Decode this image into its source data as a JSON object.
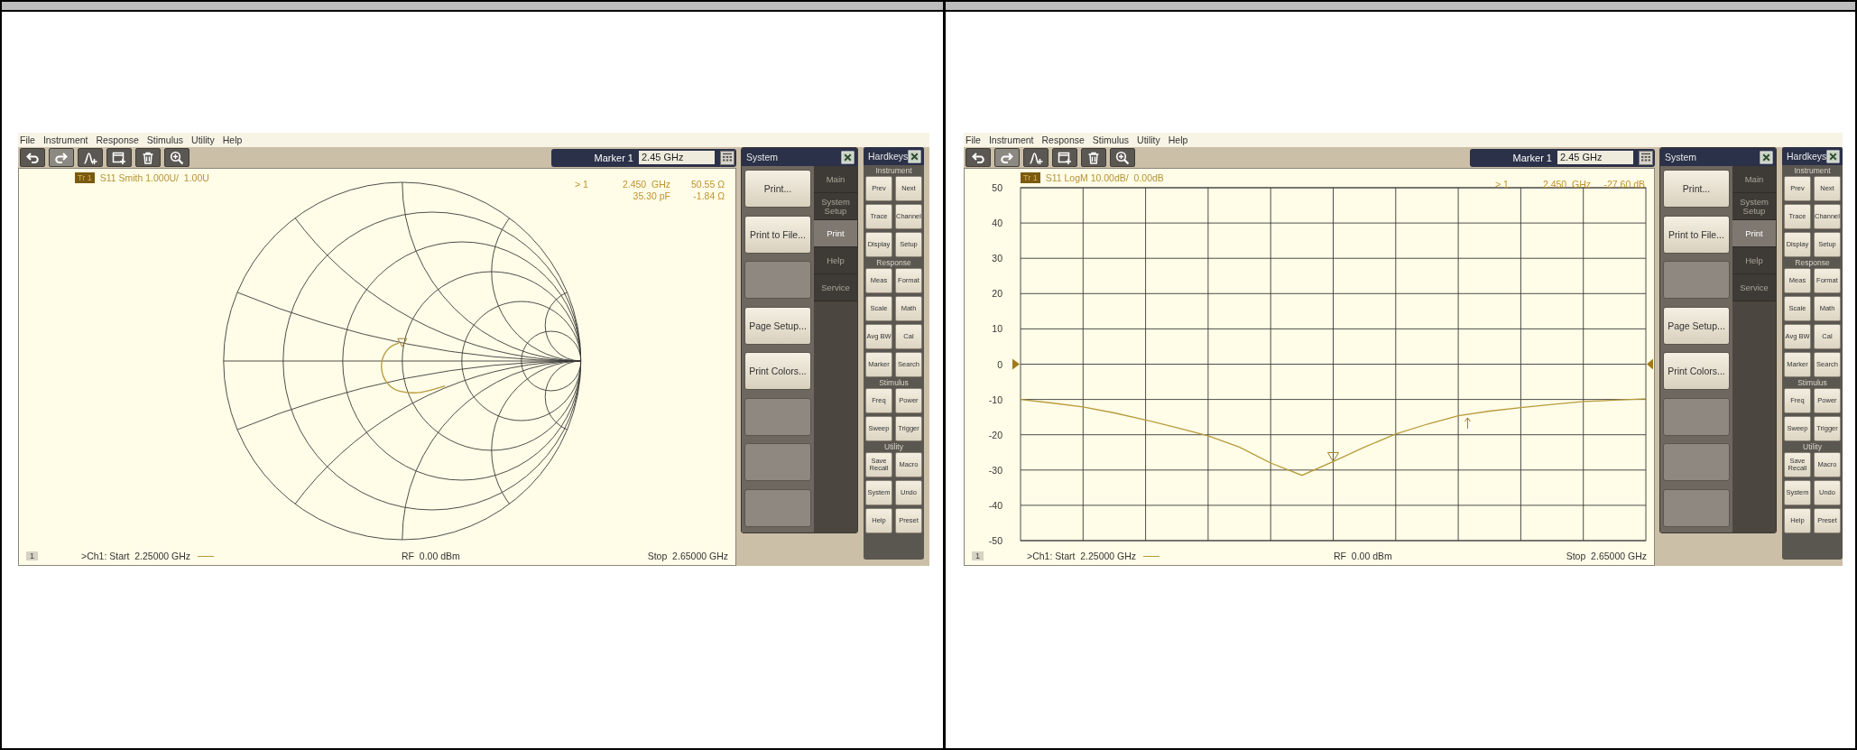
{
  "panes": [
    {
      "menu": [
        "File",
        "Instrument",
        "Response",
        "Stimulus",
        "Utility",
        "Help"
      ],
      "toolbar": [
        {
          "kind": "undo",
          "disabled": false
        },
        {
          "kind": "redo",
          "disabled": true
        },
        {
          "kind": "marker",
          "disabled": false
        },
        {
          "kind": "window",
          "disabled": false
        },
        {
          "kind": "trash",
          "disabled": false
        },
        {
          "kind": "zoom",
          "disabled": false
        }
      ],
      "marker": {
        "label": "Marker 1",
        "value": "2.45 GHz"
      },
      "chart": {
        "kind": "smith",
        "trace_badge": "Tr 1",
        "trace_label": "S11 Smith 1.000U/  1.00U",
        "readout": [
          {
            "marker": "> 1",
            "col_2": "2.450  GHz",
            "col_3": "50.55 Ω"
          },
          {
            "col_2": "35.30 pF",
            "col_3": "-1.84 Ω"
          }
        ]
      },
      "status": {
        "channel_number": "1",
        "start": ">Ch1: Start  2.25000 GHz",
        "rf": "RF  0.00 dBm",
        "stop": "Stop  2.65000 GHz"
      },
      "system": {
        "title": "System",
        "buttons": [
          {
            "kind": "action",
            "label": "Print..."
          },
          {
            "kind": "action",
            "label": "Print to File..."
          },
          {
            "kind": "blank"
          },
          {
            "kind": "action",
            "label": "Page Setup..."
          },
          {
            "kind": "action",
            "label": "Print Colors..."
          },
          {
            "kind": "blank"
          },
          {
            "kind": "blank"
          },
          {
            "kind": "blank"
          }
        ],
        "tabs": [
          {
            "label": "Main",
            "selected": false
          },
          {
            "label": "System Setup",
            "selected": false
          },
          {
            "label": "Print",
            "selected": true
          },
          {
            "label": "Help",
            "selected": false
          },
          {
            "label": "Service",
            "selected": false
          }
        ]
      },
      "hardkeys": {
        "title": "Hardkeys",
        "groups": [
          {
            "label": "Instrument",
            "keys": [
              "Prev",
              "Next",
              "Trace",
              "Channel",
              "Display",
              "Setup"
            ]
          },
          {
            "label": "Response",
            "keys": [
              "Meas",
              "Format",
              "Scale",
              "Math",
              "Avg BW",
              "Cal",
              "Marker",
              "Search"
            ]
          },
          {
            "label": "Stimulus",
            "keys": [
              "Freq",
              "Power",
              "Sweep",
              "Trigger"
            ]
          },
          {
            "label": "Utility",
            "keys": [
              "Save Recall",
              "Macro",
              "System",
              "Undo",
              "Help",
              "Preset"
            ]
          }
        ]
      }
    },
    {
      "menu": [
        "File",
        "Instrument",
        "Response",
        "Stimulus",
        "Utility",
        "Help"
      ],
      "toolbar": [
        {
          "kind": "undo",
          "disabled": false
        },
        {
          "kind": "redo",
          "disabled": true
        },
        {
          "kind": "marker",
          "disabled": false
        },
        {
          "kind": "window",
          "disabled": false
        },
        {
          "kind": "trash",
          "disabled": false
        },
        {
          "kind": "zoom",
          "disabled": false
        }
      ],
      "marker": {
        "label": "Marker 1",
        "value": "2.45 GHz"
      },
      "chart": {
        "kind": "logm",
        "trace_badge": "Tr 1",
        "trace_label": "S11 LogM 10.00dB/  0.00dB",
        "readout": [
          {
            "marker": "> 1",
            "col_2": "2.450  GHz",
            "col_3": "-27.60 dB"
          }
        ],
        "chart_data": {
          "type": "line",
          "grid": true,
          "ylim": [
            -50,
            50
          ],
          "yticks": [
            50,
            40,
            30,
            20,
            10,
            0,
            -10,
            -20,
            -30,
            -40,
            -50
          ],
          "categories": [
            null,
            null,
            null,
            null,
            null,
            null,
            null,
            null,
            null,
            null,
            null,
            null,
            null,
            null,
            null,
            null,
            null,
            null,
            null,
            null,
            null
          ],
          "series": [
            {
              "color": "#b89a3c",
              "values": [
                -10,
                -11,
                -12.1,
                -13.8,
                -15.8,
                -18,
                -20.3,
                -23.5,
                -28,
                -31.5,
                -27.6,
                -23.5,
                -19.8,
                -17,
                -14.6,
                -13.3,
                -12.3,
                -11.4,
                -10.6,
                -10.2,
                -9.8
              ]
            }
          ]
        }
      },
      "status": {
        "channel_number": "1",
        "start": ">Ch1: Start  2.25000 GHz",
        "rf": "RF  0.00 dBm",
        "stop": "Stop  2.65000 GHz"
      },
      "system": {
        "title": "System",
        "buttons": [
          {
            "kind": "action",
            "label": "Print..."
          },
          {
            "kind": "action",
            "label": "Print to File..."
          },
          {
            "kind": "blank"
          },
          {
            "kind": "action",
            "label": "Page Setup..."
          },
          {
            "kind": "action",
            "label": "Print Colors..."
          },
          {
            "kind": "blank"
          },
          {
            "kind": "blank"
          },
          {
            "kind": "blank"
          }
        ],
        "tabs": [
          {
            "label": "Main",
            "selected": false
          },
          {
            "label": "System Setup",
            "selected": false
          },
          {
            "label": "Print",
            "selected": true
          },
          {
            "label": "Help",
            "selected": false
          },
          {
            "label": "Service",
            "selected": false
          }
        ]
      },
      "hardkeys": {
        "title": "Hardkeys",
        "groups": [
          {
            "label": "Instrument",
            "keys": [
              "Prev",
              "Next",
              "Trace",
              "Channel",
              "Display",
              "Setup"
            ]
          },
          {
            "label": "Response",
            "keys": [
              "Meas",
              "Format",
              "Scale",
              "Math",
              "Avg BW",
              "Cal",
              "Marker",
              "Search"
            ]
          },
          {
            "label": "Stimulus",
            "keys": [
              "Freq",
              "Power",
              "Sweep",
              "Trigger"
            ]
          },
          {
            "label": "Utility",
            "keys": [
              "Save Recall",
              "Macro",
              "System",
              "Undo",
              "Help",
              "Preset"
            ]
          }
        ]
      }
    }
  ]
}
